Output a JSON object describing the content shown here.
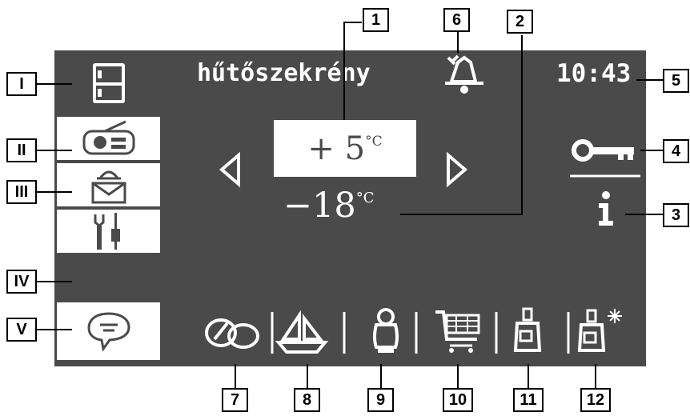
{
  "screen": {
    "title": "hűtőszekrény",
    "clock": "10:43",
    "fridge_temp": {
      "sign": "+",
      "value": " 5",
      "unit": "°C"
    },
    "freezer_temp": {
      "value": "−18",
      "unit": "°C"
    }
  },
  "sidebar": {
    "items": [
      {
        "icon": "fridge-icon"
      },
      {
        "icon": "radio-icon"
      },
      {
        "icon": "mailbox-icon"
      },
      {
        "icon": "tools-icon"
      },
      {
        "icon": "speech-bubble-icon"
      }
    ]
  },
  "right_panel": {
    "icons": [
      "key-icon",
      "info-icon"
    ]
  },
  "bottom_bar": {
    "icons": [
      "eco-icon",
      "vacation-icon",
      "penguin-icon",
      "shopping-cart-icon",
      "bottle-icon",
      "bottle-superfreeze-icon"
    ]
  },
  "colors": {
    "screen_bg": "#4a4a4a",
    "fg": "#ffffff"
  },
  "callouts": {
    "numbers": [
      "1",
      "2",
      "3",
      "4",
      "5",
      "6",
      "7",
      "8",
      "9",
      "10",
      "11",
      "12"
    ],
    "romans": [
      "I",
      "II",
      "III",
      "IV",
      "V"
    ]
  }
}
